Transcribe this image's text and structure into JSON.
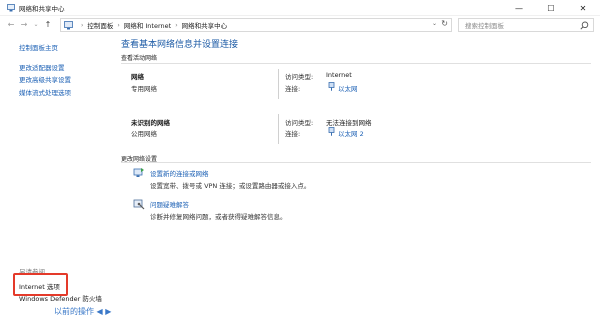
{
  "window": {
    "title": "网络和共享中心",
    "minimize_glyph": "—",
    "maximize_glyph": "☐",
    "close_glyph": "✕"
  },
  "address_bar": {
    "back_glyph": "←",
    "forward_glyph": "→",
    "dropdown_glyph": "⌄",
    "up_glyph": "↑",
    "breadcrumbs": [
      "控制面板",
      "网络和 Internet",
      "网络和共享中心"
    ],
    "breadcrumb_separator": "›",
    "history_glyph": "⌄",
    "refresh_glyph": "↻",
    "search_placeholder": "搜索控制面板"
  },
  "sidebar": {
    "links": [
      "控制面板主页",
      "更改适配器设置",
      "更改高级共享设置",
      "媒体流式处理选项"
    ],
    "see_also_label": "另请参阅",
    "internet_options": "Internet 选项",
    "defender": "Windows Defender 防火墙"
  },
  "main": {
    "title": "查看基本网络信息并设置连接",
    "active_networks_label": "查看活动网络",
    "networks": [
      {
        "name": "网络",
        "profile": "专用网络",
        "access_type_label": "访问类型:",
        "access_type_value": "Internet",
        "connection_label": "连接:",
        "connection_value": "以太网"
      },
      {
        "name": "未识别的网络",
        "profile": "公用网络",
        "access_type_label": "访问类型:",
        "access_type_value": "无法连接到网络",
        "connection_label": "连接:",
        "connection_value": "以太网 2"
      }
    ],
    "change_settings_label": "更改网络设置",
    "tasks": [
      {
        "icon": "network-setup-icon",
        "link": "设置新的连接或网络",
        "description": "设置宽带、拨号或 VPN 连接；或设置路由器或接入点。"
      },
      {
        "icon": "troubleshoot-icon",
        "link": "问题疑难解答",
        "description": "诊断并修复网络问题，或者获得疑难解答信息。"
      }
    ]
  },
  "footer": {
    "cutoff_text": "以前的操作 ◀ ▶"
  },
  "colors": {
    "link": "#1a5fb4",
    "title": "#1d5ba6",
    "highlight": "#e43a2a"
  }
}
